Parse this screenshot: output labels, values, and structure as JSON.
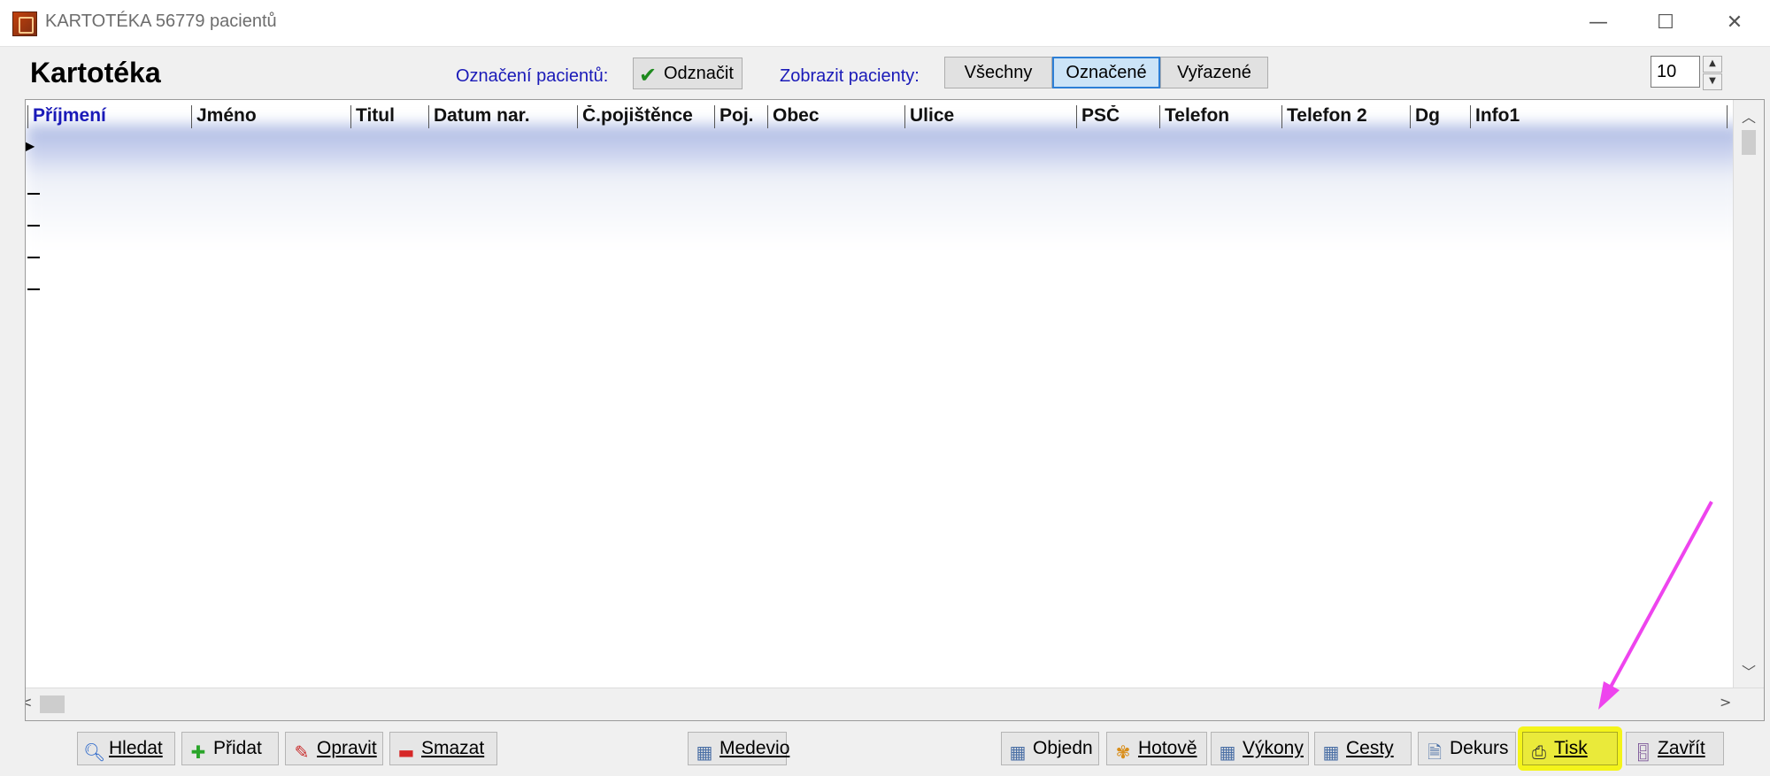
{
  "window": {
    "title": "KARTOTÉKA 56779 pacientů",
    "minimize": "—",
    "maximize": "☐",
    "close": "✕"
  },
  "header": {
    "title": "Kartotéka",
    "mark_label": "Označení pacientů:",
    "unmark_button": "Odznačit",
    "show_label": "Zobrazit pacienty:",
    "filters": [
      "Všechny",
      "Označené",
      "Vyřazené"
    ],
    "active_filter": "Označené",
    "rows_value": "10"
  },
  "grid": {
    "columns": [
      "Příjmení",
      "Jméno",
      "Titul",
      "Datum nar.",
      "Č.pojištěnce",
      "Poj.",
      "Obec",
      "Ulice",
      "PSČ",
      "Telefon",
      "Telefon 2",
      "Dg",
      "Info1"
    ],
    "sorted_column": "Příjmení"
  },
  "toolbar": {
    "search": "Hledat",
    "add": "Přidat",
    "edit": "Opravit",
    "delete": "Smazat",
    "medevio": "Medevio",
    "orders": "Objedn",
    "cash": "Hotově",
    "procedures": "Výkony",
    "trips": "Cesty",
    "decursus": "Dekurs",
    "print": "Tisk",
    "close": "Zavřít"
  },
  "colors": {
    "highlight": "#f4f41a",
    "annotation_arrow": "#ee44ee",
    "label_blue": "#1a1ab8"
  }
}
